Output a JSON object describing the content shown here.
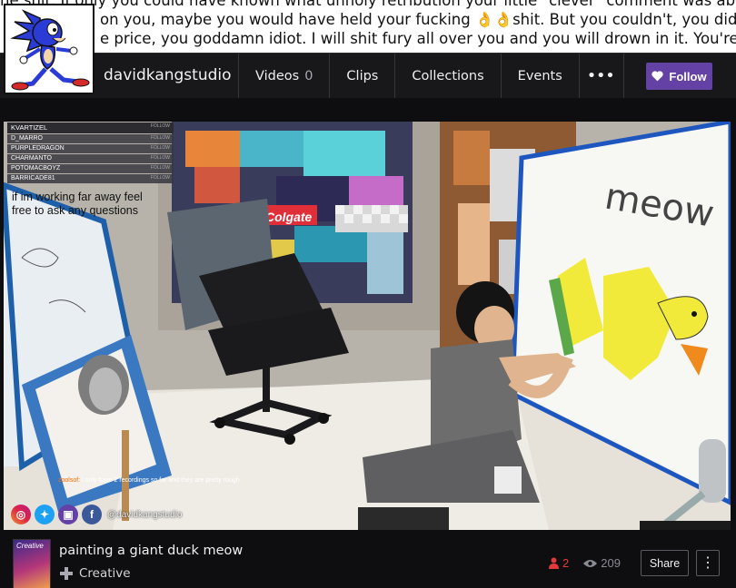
{
  "banner": {
    "line1": "he shit. If only you could have known what unholy retribution your little \"clever\" comment was about",
    "line2": "on you, maybe you would have held your fucking 👌👌shit. But you couldn't, you didn't, and now",
    "line3": "e price, you goddamn idiot. I will shit fury all over you and you will drown in it. You're fucking dead,"
  },
  "channel": {
    "name": "davidkangstudio",
    "avatar_icon": "sonic-drawing-icon"
  },
  "nav": {
    "tabs": [
      {
        "label": "Videos",
        "count": "0"
      },
      {
        "label": "Clips"
      },
      {
        "label": "Collections"
      },
      {
        "label": "Events"
      }
    ],
    "more_label": "•••",
    "follow_label": "Follow",
    "follow_color": "#6441a5"
  },
  "player": {
    "chat": {
      "header": "KVARTIZEL",
      "header_action": "FOLLOW",
      "rows": [
        {
          "name": "D_MARRO",
          "action": "FOLLOW"
        },
        {
          "name": "PURPLEDRAGON",
          "action": "FOLLOW"
        },
        {
          "name": "CHARMANTO",
          "action": "FOLLOW"
        },
        {
          "name": "POTOMACBOYZ",
          "action": "FOLLOW"
        },
        {
          "name": "BARRICADE81",
          "action": "FOLLOW"
        }
      ]
    },
    "note": "if im working far away feel free to ask any questions",
    "subtitle_user": "zoolsof:",
    "subtitle_text": "i only have 2 recordings so far and they are pretty rough",
    "canvas_text": "meow",
    "brand_text": "Colgate",
    "social_handle": "@davidkangstudio",
    "social_icons": [
      "instagram-icon",
      "twitter-icon",
      "twitch-icon",
      "facebook-icon"
    ]
  },
  "video": {
    "title": "painting a giant duck meow",
    "game_name": "Creative",
    "game_art_text": "Creative",
    "likes": "2",
    "views": "209",
    "share_label": "Share",
    "more_label": "⋮",
    "like_color": "#e03a3a"
  }
}
